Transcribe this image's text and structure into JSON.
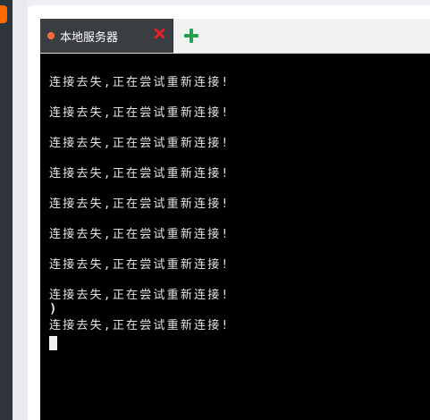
{
  "tab": {
    "label": "本地服务器"
  },
  "terminal": {
    "lines": [
      "连接去失,正在尝试重新连接!",
      "连接去失,正在尝试重新连接!",
      "连接去失,正在尝试重新连接!",
      "连接去失,正在尝试重新连接!",
      "连接去失,正在尝试重新连接!",
      "连接去失,正在尝试重新连接!",
      "连接去失,正在尝试重新连接!",
      "连接去失,正在尝试重新连接!",
      "连接去失,正在尝试重新连接!"
    ],
    "stray_glyph": ")"
  },
  "colors": {
    "tab_active": "#3a3d41",
    "tab_dot": "#ff6a3d",
    "close_icon": "#e0242a",
    "add_icon": "#23a24d",
    "terminal_bg": "#000000",
    "terminal_text": "#e6e6e6"
  }
}
